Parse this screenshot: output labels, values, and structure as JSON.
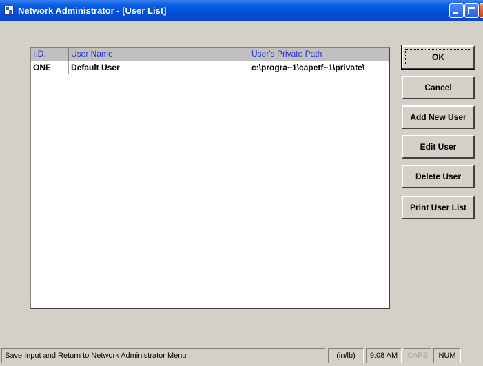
{
  "window": {
    "title": "Network Administrator - [User List]",
    "icon": "app-window-icon"
  },
  "colors": {
    "title_bar": "#0a5ee0",
    "header_text": "#2232c8",
    "face": "#d4d0c8",
    "caps_disabled": "#a0a0a0"
  },
  "grid": {
    "columns": [
      "I.D.",
      "User Name",
      "User's Private Path"
    ],
    "rows": [
      [
        "ONE",
        "Default User",
        "c:\\progra~1\\capetf~1\\private\\"
      ]
    ]
  },
  "buttons": {
    "ok": "OK",
    "cancel": "Cancel",
    "add_new_user": "Add New User",
    "edit_user": "Edit User",
    "delete_user": "Delete User",
    "print_user_list": "Print User List"
  },
  "status": {
    "message": "Save Input and Return to Network Administrator Menu",
    "units": "(in/lb)",
    "time": "9:08 AM",
    "caps": "CAPS",
    "num": "NUM"
  }
}
